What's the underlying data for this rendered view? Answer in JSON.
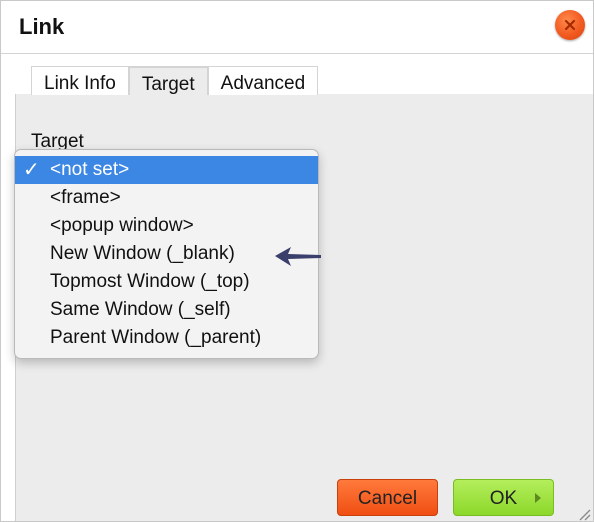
{
  "dialog": {
    "title": "Link",
    "close_icon": "close-icon"
  },
  "tabs": [
    {
      "label": "Link Info",
      "active": false
    },
    {
      "label": "Target",
      "active": true
    },
    {
      "label": "Advanced",
      "active": false
    }
  ],
  "target": {
    "label": "Target",
    "selected": "<not set>",
    "options": [
      "<not set>",
      "<frame>",
      "<popup window>",
      "New Window (_blank)",
      "Topmost Window (_top)",
      "Same Window (_self)",
      "Parent Window (_parent)"
    ]
  },
  "buttons": {
    "cancel": "Cancel",
    "ok": "OK"
  },
  "colors": {
    "selection": "#3c87e3",
    "cancel": "#f25a1f",
    "ok": "#9be23a",
    "arrow": "#3a3f6b"
  }
}
